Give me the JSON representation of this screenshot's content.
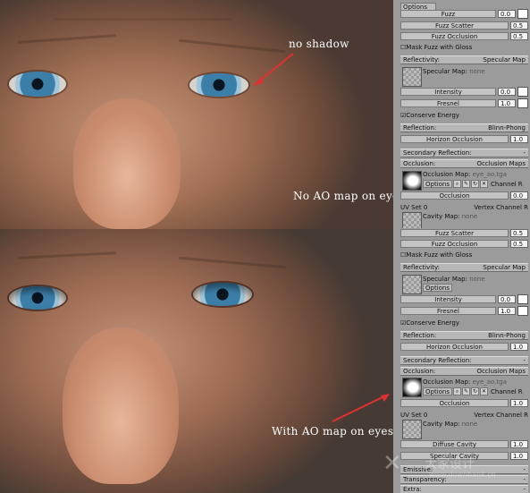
{
  "annotations": {
    "top_right": "no shadow",
    "top_bottom": "No AO map on eyes",
    "bottom": "With AO map on eyes"
  },
  "panel_top": {
    "fuzz_label": "Fuzz",
    "fuzz_value": "0.0",
    "options_label": "Options",
    "fuzz_scatter_label": "Fuzz Scatter",
    "fuzz_scatter_value": "0.5",
    "fuzz_occlusion_label": "Fuzz Occlusion",
    "fuzz_occlusion_value": "0.5",
    "mask_fuzz_label": "Mask Fuzz with Gloss",
    "reflectivity_header": "Reflectivity:",
    "reflectivity_mode": "Specular Map",
    "specular_map_label": "Specular Map:",
    "specular_map_value": "none",
    "intensity_label": "Intensity",
    "intensity_value": "0.0",
    "fresnel_label": "Fresnel",
    "fresnel_value": "1.0",
    "conserve_energy_label": "Conserve Energy",
    "reflection_header": "Reflection:",
    "reflection_mode": "Blinn-Phong",
    "horizon_occlusion_label": "Horizon Occlusion",
    "horizon_occlusion_value": "1.0",
    "secondary_reflection_header": "Secondary Reflection:",
    "occlusion_header": "Occlusion:",
    "occlusion_mode": "Occlusion Maps",
    "occlusion_map_label": "Occlusion Map:",
    "occlusion_map_file": "eye_ao.tga",
    "channel_label": "Channel",
    "channel_value": "R",
    "occlusion_value_label": "Occlusion",
    "occlusion_value": "0.0",
    "uv_set_label": "UV Set",
    "uv_set_value": "0",
    "vertex_channel_label": "Vertex Channel",
    "vertex_channel_value": "R",
    "cavity_map_label": "Cavity Map:",
    "cavity_map_value": "none"
  },
  "panel_bottom": {
    "fuzz_scatter_label": "Fuzz Scatter",
    "fuzz_scatter_value": "0.5",
    "fuzz_occlusion_label": "Fuzz Occlusion",
    "fuzz_occlusion_value": "0.5",
    "mask_fuzz_label": "Mask Fuzz with Gloss",
    "reflectivity_header": "Reflectivity:",
    "reflectivity_mode": "Specular Map",
    "specular_map_label": "Specular Map:",
    "specular_map_value": "none",
    "options_label": "Options",
    "intensity_label": "Intensity",
    "intensity_value": "0.0",
    "fresnel_label": "Fresnel",
    "fresnel_value": "1.0",
    "conserve_energy_label": "Conserve Energy",
    "reflection_header": "Reflection:",
    "reflection_mode": "Blinn-Phong",
    "horizon_occlusion_label": "Horizon Occlusion",
    "horizon_occlusion_value": "1.0",
    "secondary_reflection_header": "Secondary Reflection:",
    "occlusion_header": "Occlusion:",
    "occlusion_mode": "Occlusion Maps",
    "occlusion_map_label": "Occlusion Map:",
    "occlusion_map_file": "eye_ao.tga",
    "channel_label": "Channel",
    "channel_value": "R",
    "occlusion_value_label": "Occlusion",
    "occlusion_value": "1.0",
    "uv_set_label": "UV Set",
    "uv_set_value": "0",
    "vertex_channel_label": "Vertex Channel",
    "vertex_channel_value": "R",
    "cavity_map_label": "Cavity Map:",
    "cavity_map_value": "none",
    "diffuse_cavity_label": "Diffuse Cavity",
    "diffuse_cavity_value": "1.0",
    "specular_cavity_label": "Specular Cavity",
    "specular_cavity_value": "1.0",
    "emissive_header": "Emissive:",
    "transparency_header": "Transparency:",
    "extra_header": "Extra:"
  },
  "watermark": {
    "brand": "大家设计",
    "url": "www.downbank.cn"
  },
  "colors": {
    "panel_bg": "#9b9b9b",
    "header_bg": "#b7b7b7",
    "arrow": "#e03030"
  }
}
